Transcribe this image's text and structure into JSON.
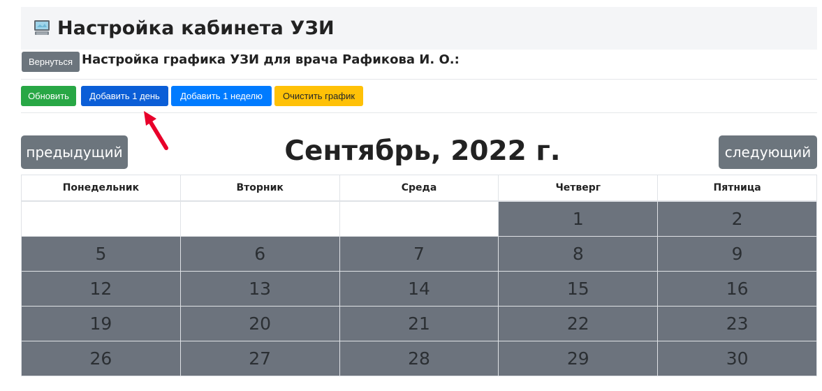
{
  "header": {
    "title": "Настройка кабинета УЗИ",
    "icon": "computer-icon"
  },
  "back_label": "Вернуться",
  "subtitle": "Настройка графика УЗИ для врача Рафикова И. О.:",
  "toolbar": {
    "refresh_label": "Обновить",
    "add_day_label": "Добавить 1 день",
    "add_week_label": "Добавить 1 неделю",
    "clear_label": "Очистить график"
  },
  "calendar": {
    "prev_label": "предыдущий",
    "next_label": "следующий",
    "month_title": "Сентябрь, 2022 г.",
    "weekdays": [
      "Понедельник",
      "Вторник",
      "Среда",
      "Четверг",
      "Пятница"
    ],
    "weeks": [
      [
        "",
        "",
        "",
        "1",
        "2"
      ],
      [
        "5",
        "6",
        "7",
        "8",
        "9"
      ],
      [
        "12",
        "13",
        "14",
        "15",
        "16"
      ],
      [
        "19",
        "20",
        "21",
        "22",
        "23"
      ],
      [
        "26",
        "27",
        "28",
        "29",
        "30"
      ]
    ]
  },
  "colors": {
    "success": "#28a745",
    "primary_dark": "#0b5ed7",
    "primary": "#007bff",
    "warning": "#ffc107",
    "secondary": "#6c757d",
    "annotation_arrow": "#e8002a"
  }
}
